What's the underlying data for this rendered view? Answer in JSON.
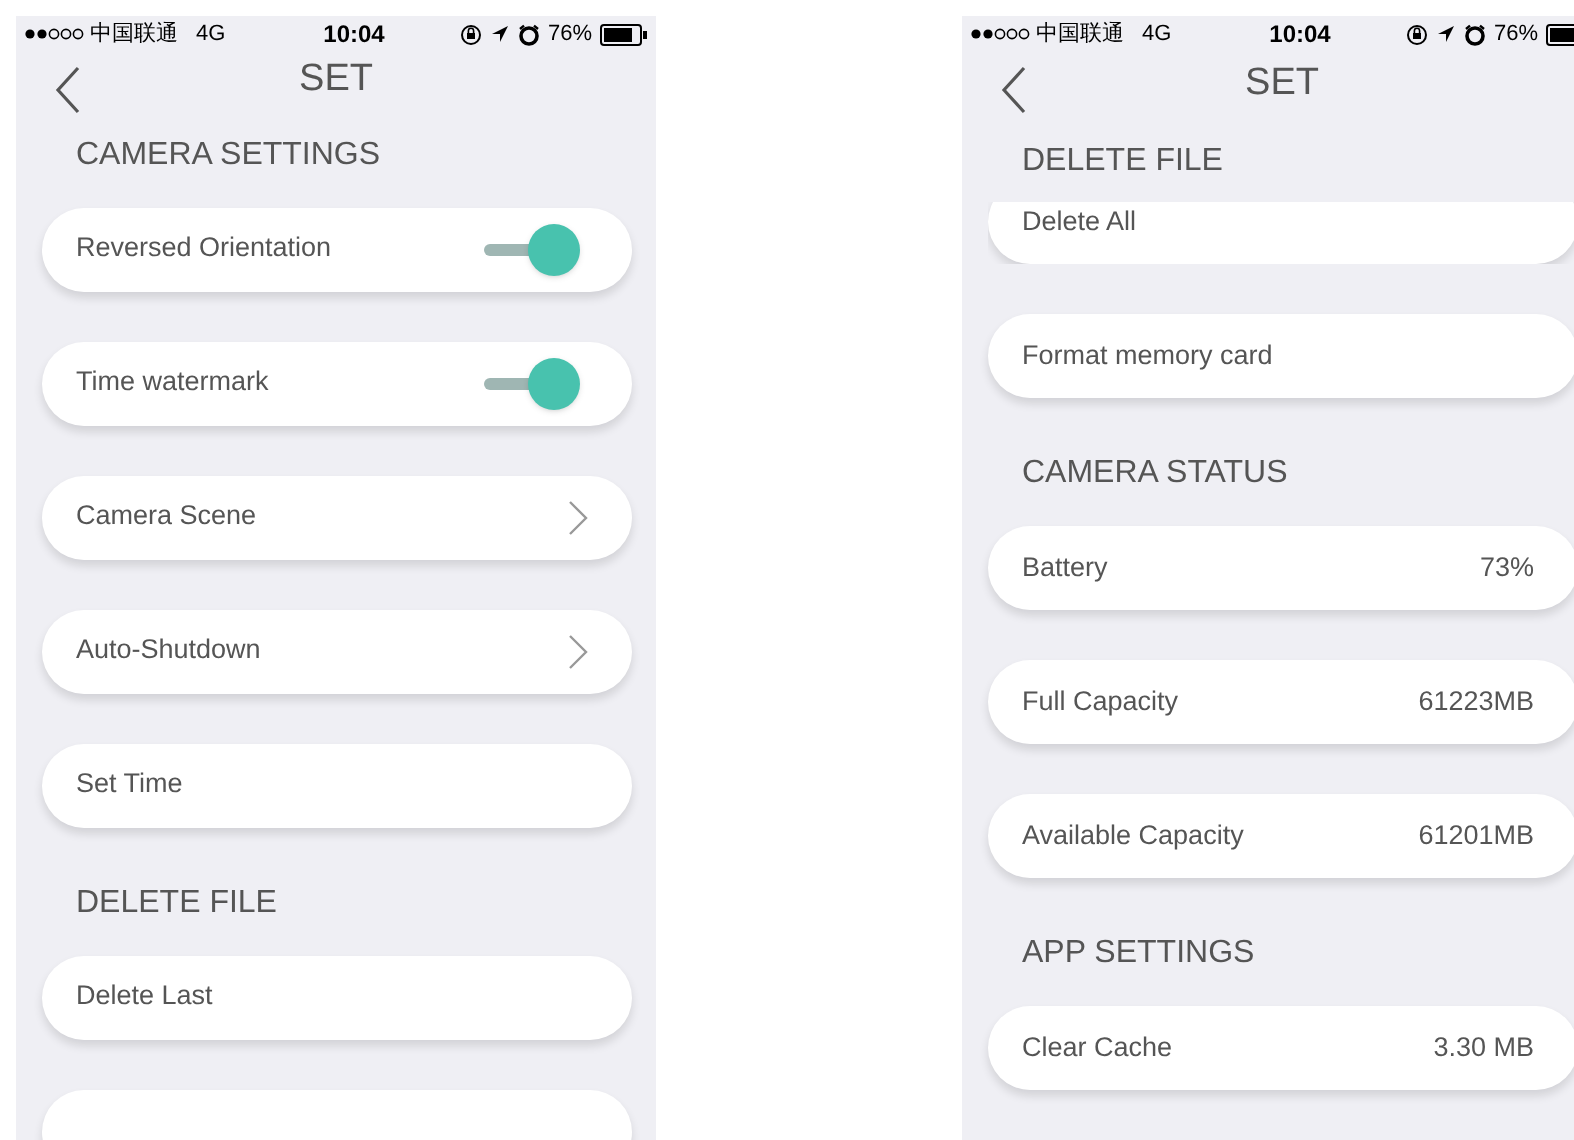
{
  "screens": [
    {
      "status_bar": {
        "carrier": "中国联通",
        "network": "4G",
        "time": "10:04",
        "battery": "76%"
      },
      "title": "SET",
      "items": [
        {
          "kind": "header",
          "label": "CAMERA SETTINGS"
        },
        {
          "kind": "toggle",
          "label": "Reversed Orientation",
          "on": true
        },
        {
          "kind": "toggle",
          "label": "Time watermark",
          "on": true
        },
        {
          "kind": "link",
          "label": "Camera Scene"
        },
        {
          "kind": "link",
          "label": "Auto-Shutdown"
        },
        {
          "kind": "plain",
          "label": "Set Time"
        },
        {
          "kind": "header",
          "label": "DELETE FILE"
        },
        {
          "kind": "plain",
          "label": "Delete Last"
        },
        {
          "kind": "blank"
        }
      ]
    },
    {
      "status_bar": {
        "carrier": "中国联通",
        "network": "4G",
        "time": "10:04",
        "battery": "76%"
      },
      "title": "SET",
      "items": [
        {
          "kind": "header",
          "label": "DELETE FILE"
        },
        {
          "kind": "plain",
          "label": "Delete All",
          "cut": true
        },
        {
          "kind": "plain",
          "label": "Format memory card"
        },
        {
          "kind": "header",
          "label": "CAMERA STATUS"
        },
        {
          "kind": "value",
          "label": "Battery",
          "value": "73%"
        },
        {
          "kind": "value",
          "label": "Full Capacity",
          "value": "61223MB"
        },
        {
          "kind": "value",
          "label": "Available Capacity",
          "value": "61201MB"
        },
        {
          "kind": "header",
          "label": "APP SETTINGS"
        },
        {
          "kind": "value",
          "label": "Clear Cache",
          "value": "3.30 MB"
        }
      ]
    }
  ]
}
